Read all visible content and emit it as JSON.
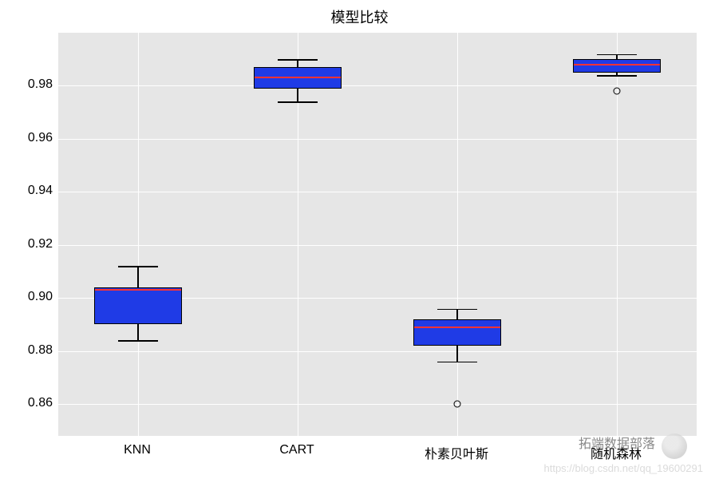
{
  "chart_data": {
    "type": "boxplot",
    "title": "模型比较",
    "categories": [
      "KNN",
      "CART",
      "朴素贝叶斯",
      "随机森林"
    ],
    "ylim": [
      0.848,
      1.0
    ],
    "yticks": [
      0.86,
      0.88,
      0.9,
      0.92,
      0.94,
      0.96,
      0.98
    ],
    "series": [
      {
        "name": "KNN",
        "q1": 0.89,
        "median": 0.903,
        "q3": 0.904,
        "whisker_low": 0.884,
        "whisker_high": 0.912,
        "outliers": []
      },
      {
        "name": "CART",
        "q1": 0.979,
        "median": 0.983,
        "q3": 0.987,
        "whisker_low": 0.974,
        "whisker_high": 0.99,
        "outliers": []
      },
      {
        "name": "朴素贝叶斯",
        "q1": 0.882,
        "median": 0.889,
        "q3": 0.892,
        "whisker_low": 0.876,
        "whisker_high": 0.896,
        "outliers": [
          0.86
        ]
      },
      {
        "name": "随机森林",
        "q1": 0.985,
        "median": 0.988,
        "q3": 0.99,
        "whisker_low": 0.984,
        "whisker_high": 0.992,
        "outliers": [
          0.978
        ]
      }
    ]
  },
  "watermark": {
    "line1": "拓端数据部落",
    "line2": "https://blog.csdn.net/qq_19600291"
  }
}
